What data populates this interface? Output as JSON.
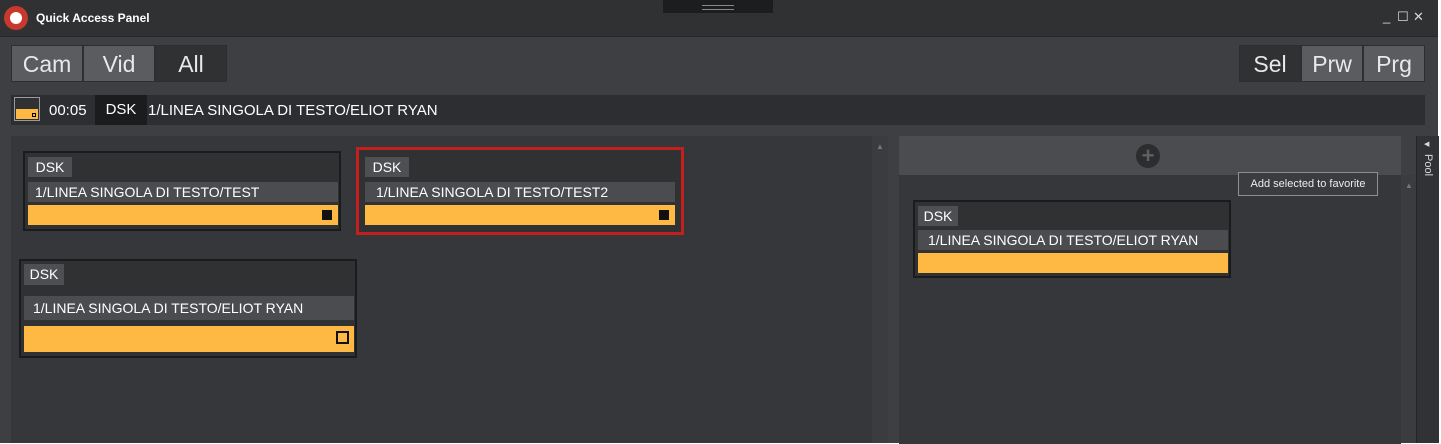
{
  "window": {
    "title": "Quick Access Panel"
  },
  "controls": {
    "minimize": "_",
    "maximize": "☐",
    "close": "✕"
  },
  "filters": [
    "Cam",
    "Vid",
    "All"
  ],
  "modes": [
    "Sel",
    "Prw",
    "Prg"
  ],
  "info_bar": {
    "time": "00:05",
    "tag": "DSK",
    "name": "1/LINEA SINGOLA DI TESTO/ELIOT RYAN"
  },
  "pool_cards": [
    {
      "tag": "DSK",
      "name": "1/LINEA SINGOLA DI TESTO/TEST"
    },
    {
      "tag": "DSK",
      "name": "1/LINEA SINGOLA DI TESTO/TEST2"
    },
    {
      "tag": "DSK",
      "name": "1/LINEA SINGOLA DI TESTO/ELIOT RYAN"
    }
  ],
  "favorites": [
    {
      "tag": "DSK",
      "name": "1/LINEA SINGOLA DI TESTO/ELIOT RYAN"
    }
  ],
  "tooltip": "Add selected to favorite",
  "side_tab": "Pool",
  "colors": {
    "accent": "#fdb944",
    "selection": "#c41f1f"
  }
}
